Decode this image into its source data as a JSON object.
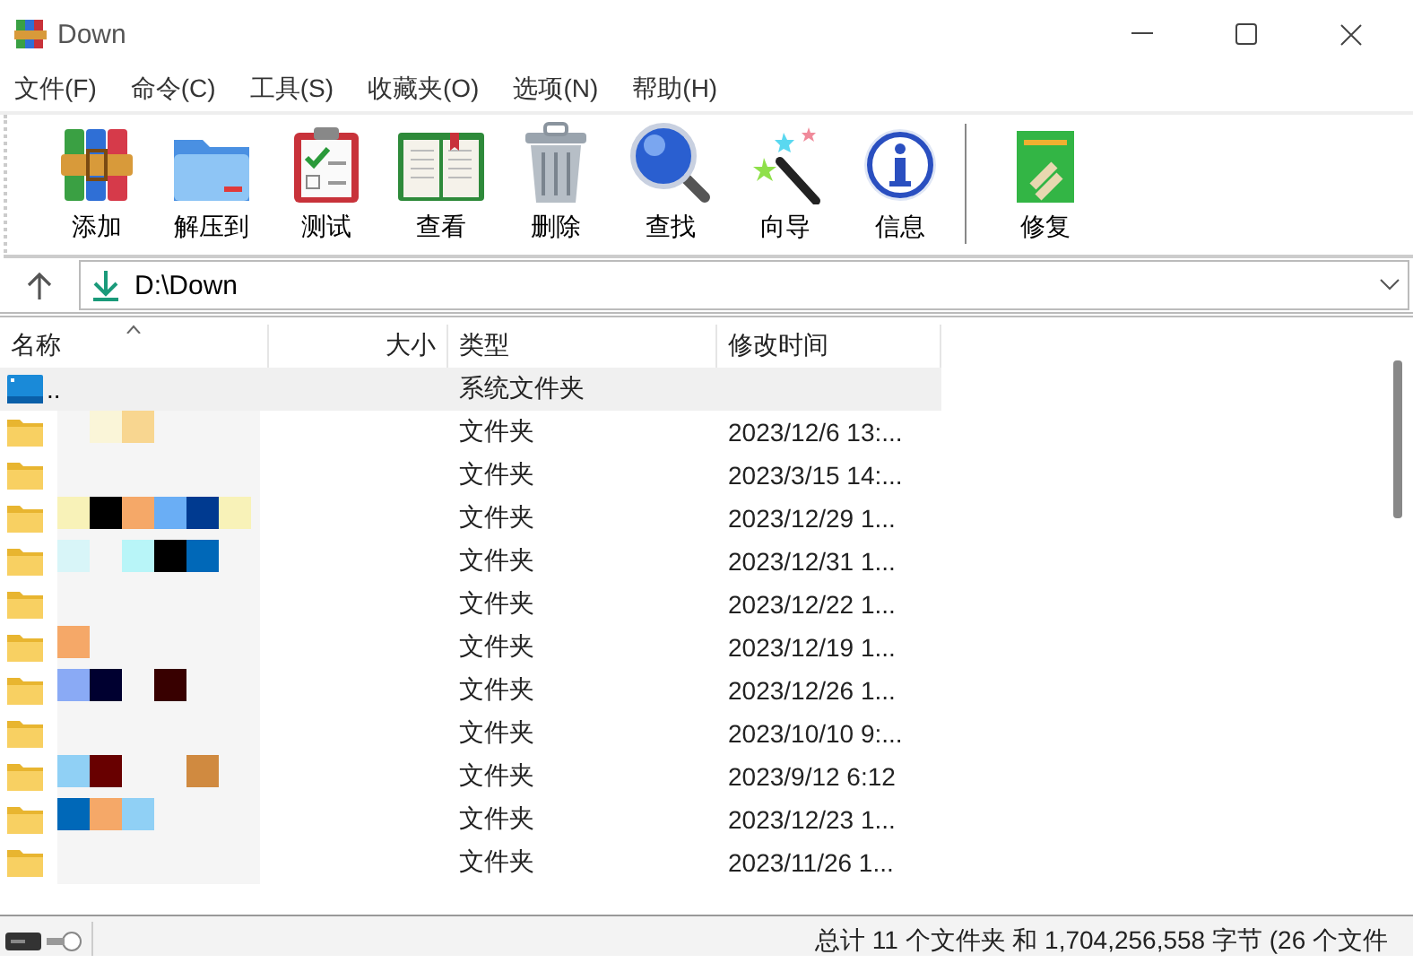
{
  "window": {
    "title": "Down"
  },
  "menu": [
    "文件(F)",
    "命令(C)",
    "工具(S)",
    "收藏夹(O)",
    "选项(N)",
    "帮助(H)"
  ],
  "toolbar": [
    {
      "kind": "add",
      "label": "添加"
    },
    {
      "kind": "extract",
      "label": "解压到"
    },
    {
      "kind": "test",
      "label": "测试"
    },
    {
      "kind": "view",
      "label": "查看"
    },
    {
      "kind": "delete",
      "label": "删除"
    },
    {
      "kind": "find",
      "label": "查找"
    },
    {
      "kind": "wizard",
      "label": "向导"
    },
    {
      "kind": "info",
      "label": "信息"
    },
    {
      "kind": "separator"
    },
    {
      "kind": "repair",
      "label": "修复"
    }
  ],
  "address": {
    "path": "D:\\Down"
  },
  "table": {
    "columns": [
      "名称",
      "大小",
      "类型",
      "修改时间"
    ],
    "rows": [
      {
        "kind": "parent",
        "name": "..",
        "type": "系统文件夹",
        "selected": true
      },
      {
        "kind": "folder",
        "type": "文件夹",
        "modified": "2023/12/6 13:...",
        "selected": false
      },
      {
        "kind": "folder",
        "type": "文件夹",
        "modified": "2023/3/15 14:...",
        "selected": false
      },
      {
        "kind": "folder",
        "type": "文件夹",
        "modified": "2023/12/29 1...",
        "selected": false
      },
      {
        "kind": "folder",
        "type": "文件夹",
        "modified": "2023/12/31 1...",
        "selected": false
      },
      {
        "kind": "folder",
        "type": "文件夹",
        "modified": "2023/12/22 1...",
        "selected": false
      },
      {
        "kind": "folder",
        "type": "文件夹",
        "modified": "2023/12/19 1...",
        "selected": false
      },
      {
        "kind": "folder",
        "type": "文件夹",
        "modified": "2023/12/26 1...",
        "selected": false
      },
      {
        "kind": "folder",
        "type": "文件夹",
        "modified": "2023/10/10 9:...",
        "selected": false
      },
      {
        "kind": "folder",
        "type": "文件夹",
        "modified": "2023/9/12 6:12",
        "selected": false
      },
      {
        "kind": "folder",
        "type": "文件夹",
        "modified": "2023/12/23 1...",
        "selected": false
      },
      {
        "kind": "folder",
        "type": "文件夹",
        "modified": "2023/11/26 1...",
        "selected": false
      }
    ]
  },
  "status_bar": {
    "text": "总计 11 个文件夹 和 1,704,256,558 字节 (26 个文件"
  }
}
